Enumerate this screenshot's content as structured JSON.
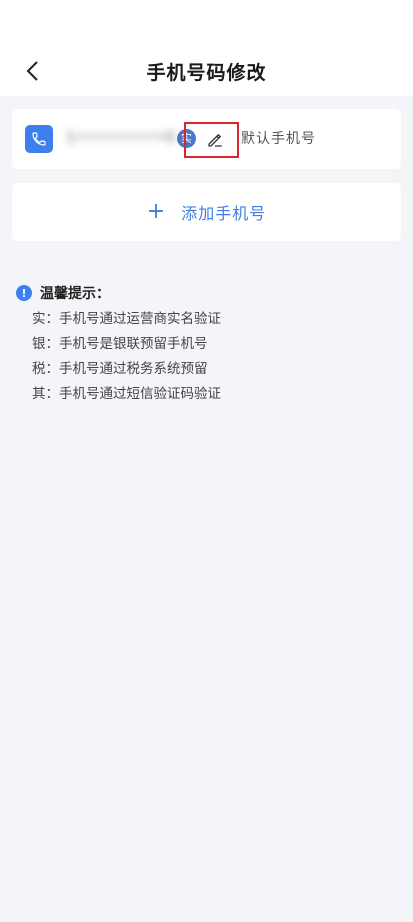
{
  "header": {
    "title": "手机号码修改",
    "back_icon": "chevron-left-icon"
  },
  "phone_card": {
    "icon": "phone-icon",
    "number": "1•••••••••0",
    "badge": "实",
    "edit_icon": "pencil-icon",
    "default_label": "默认手机号",
    "accent_color": "#3d7fec",
    "highlight_color": "#d8262e"
  },
  "add_phone": {
    "plus": "+",
    "label": "添加手机号"
  },
  "tips": {
    "icon": "info-icon",
    "icon_glyph": "!",
    "title": "温馨提示：",
    "lines": [
      "实：手机号通过运营商实名验证",
      "银：手机号是银联预留手机号",
      "税：手机号通过税务系统预留",
      "其：手机号通过短信验证码验证"
    ]
  }
}
